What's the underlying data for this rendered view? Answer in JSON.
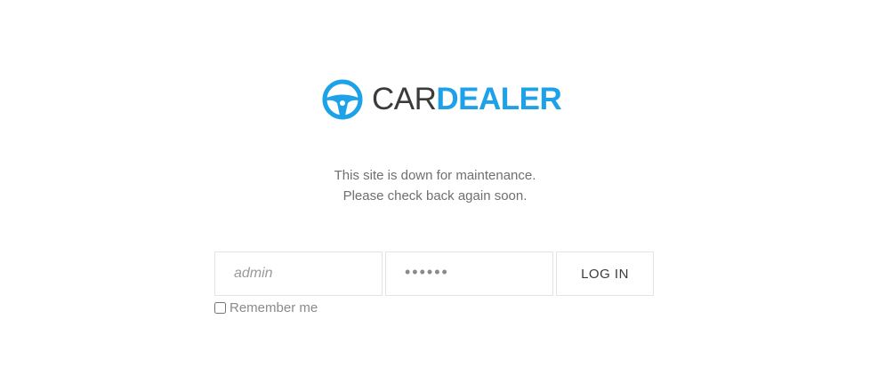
{
  "brand": {
    "name_light": "CAR",
    "name_bold": "DEALER",
    "logo_icon": "steering-wheel-icon",
    "accent_color": "#1da1e8"
  },
  "message": {
    "line1": "This site is down for maintenance.",
    "line2": "Please check back again soon."
  },
  "login": {
    "username_placeholder": "admin",
    "password_placeholder": "••••••",
    "button_label": "LOG IN",
    "remember_label": "Remember me",
    "remember_checked": false
  }
}
